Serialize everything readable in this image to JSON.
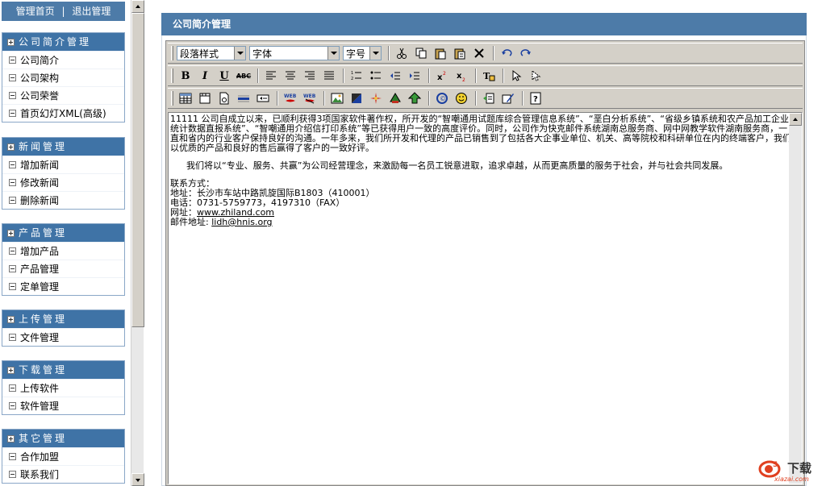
{
  "left_nav": {
    "top_links": {
      "home": "管理首页",
      "separator": "|",
      "logout": "退出管理"
    },
    "menus": [
      {
        "title": "公司简介管理",
        "items": [
          "公司简介",
          "公司架构",
          "公司荣誉",
          "首页幻灯XML(高级)"
        ]
      },
      {
        "title": "新闻管理",
        "items": [
          "增加新闻",
          "修改新闻",
          "删除新闻"
        ]
      },
      {
        "title": "产品管理",
        "items": [
          "增加产品",
          "产品管理",
          "定单管理"
        ]
      },
      {
        "title": "上传管理",
        "items": [
          "文件管理"
        ]
      },
      {
        "title": "下载管理",
        "items": [
          "上传软件",
          "软件管理"
        ]
      },
      {
        "title": "其它管理",
        "items": [
          "合作加盟",
          "联系我们"
        ]
      }
    ]
  },
  "main": {
    "title": "公司简介管理",
    "toolbar": {
      "paragraph_style": "段落样式",
      "font": "字体",
      "font_size": "字号",
      "bold": "B",
      "italic": "I",
      "underline": "U",
      "strike": "ABC"
    },
    "content": {
      "para1": "11111   公司自成立以来，已顺利获得3项国家软件著作权，所开发的“智嘲通用试题库综合管理信息系统”、“垩白分析系统”、“省级乡镇系统和农产品加工企业统计数据直报系统”、“智嘲通用介绍信打印系统”等已获得用户一致的高度评价。同时，公司作为快克邮件系统湖南总服务商、网中网教学软件湖南服务商，一直和省内的行业客户保持良好的沟通。一年多来，我们所开发和代理的产品已销售到了包括各大企事业单位、机关、高等院校和科研单位在内的终端客户，我们以优质的产品和良好的售后赢得了客户的一致好评。",
      "para2": "我们将以“专业、服务、共赢”为公司经营理念，来激励每一名员工锐意进取，追求卓越，从而更高质量的服务于社会，并与社会共同发展。",
      "contact_heading": "联系方式：",
      "address": "地址：长沙市车站中路凯旋国际B1803（410001）",
      "phone": "电话：0731-5759773，4197310（FAX）",
      "website_label": "网址：",
      "website": "www.zhiland.com",
      "email_label": "邮件地址: ",
      "email": "lidh@hnis.org"
    }
  },
  "watermark": {
    "brand": "下载",
    "url": "xiazai.com"
  },
  "colors": {
    "header_blue": "#4d7ba8",
    "menu_header": "#3f73a6",
    "toolbar_bg": "#d4d0c8"
  }
}
